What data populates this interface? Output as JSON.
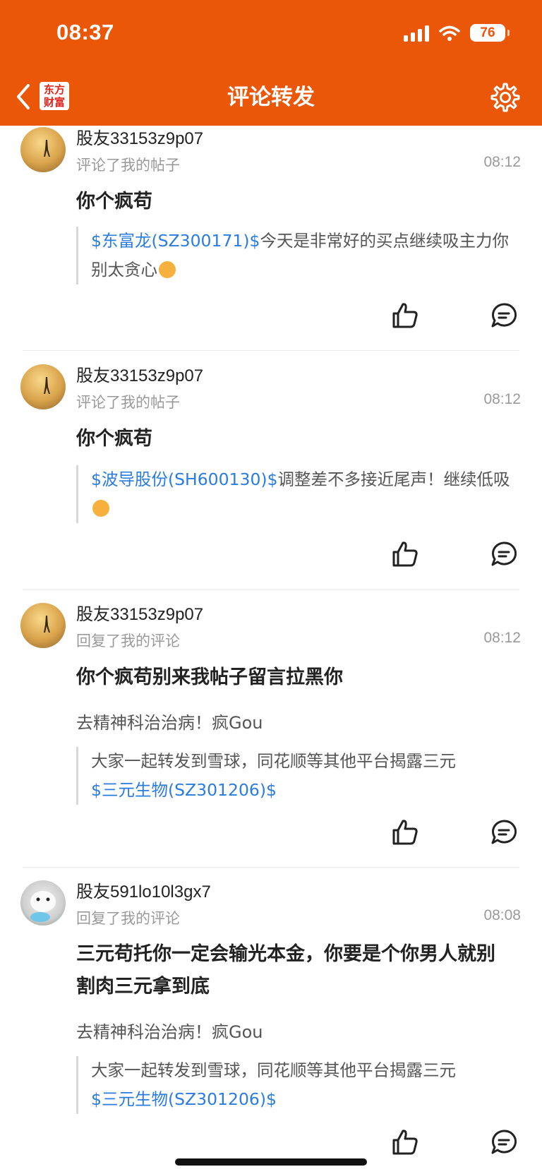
{
  "status_bar": {
    "time": "08:37",
    "battery": "76"
  },
  "header": {
    "logo_line1": "东方",
    "logo_line2": "财富",
    "title": "评论转发"
  },
  "colors": {
    "brand": "#EA5708",
    "link": "#2B7CE0"
  },
  "icons": [
    "chevron-left-icon",
    "gear-icon",
    "thumbs-up-icon",
    "comment-icon",
    "signal-icon",
    "wifi-icon",
    "battery-icon"
  ],
  "items": [
    {
      "user": "股友33153z9p07",
      "action": "评论了我的帖子",
      "time": "08:12",
      "content": "你个疯苟",
      "quote_stock": "$东富龙(SZ300171)$",
      "quote_text": "今天是非常好的买点继续吸主力你别太贪心"
    },
    {
      "user": "股友33153z9p07",
      "action": "评论了我的帖子",
      "time": "08:12",
      "content": "你个疯苟",
      "quote_stock": "$波导股份(SH600130)$",
      "quote_text": "调整差不多接近尾声！继续低吸"
    },
    {
      "user": "股友33153z9p07",
      "action": "回复了我的评论",
      "time": "08:12",
      "content": "你个疯苟别来我帖子留言拉黑你",
      "reply": "去精神科治治病！疯Gou",
      "quote_text": "大家一起转发到雪球，同花顺等其他平台揭露三元",
      "quote_stock": "$三元生物(SZ301206)$"
    },
    {
      "user": "股友591lo10l3gx7",
      "action": "回复了我的评论",
      "time": "08:08",
      "content": "三元苟托你一定会输光本金，你要是个你男人就别割肉三元拿到底",
      "reply": "去精神科治治病！疯Gou",
      "quote_text": "大家一起转发到雪球，同花顺等其他平台揭露三元",
      "quote_stock": "$三元生物(SZ301206)$"
    }
  ]
}
